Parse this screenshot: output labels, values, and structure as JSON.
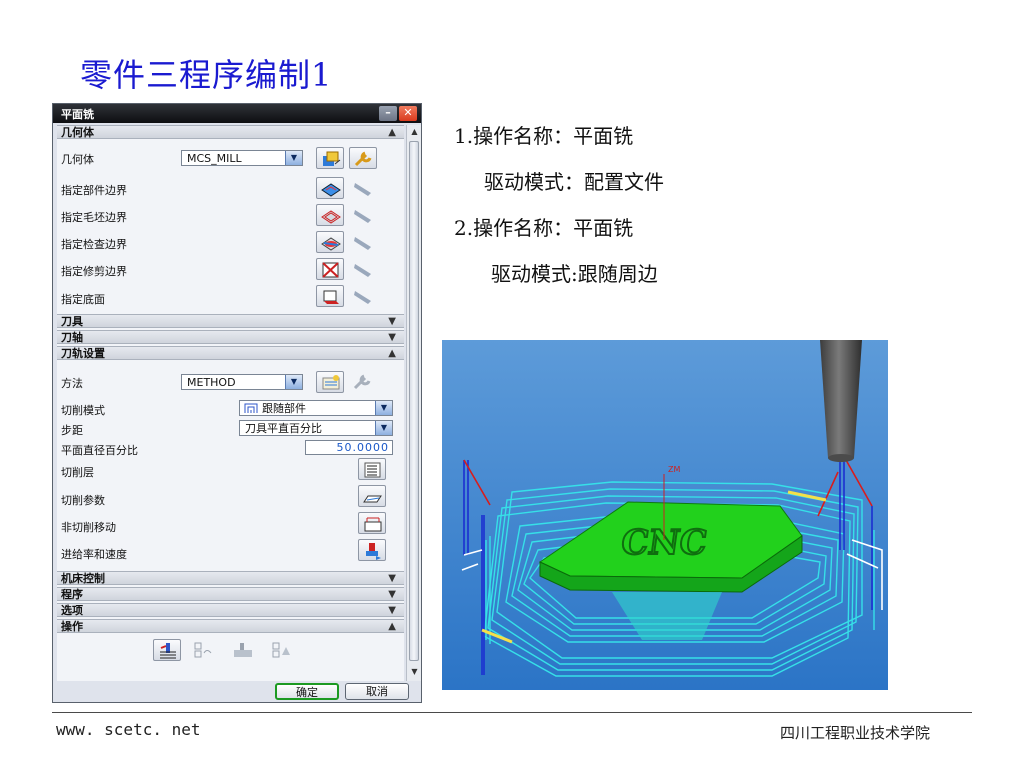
{
  "slide": {
    "title": "零件三程序编制1",
    "footer_url": "www. scetc. net",
    "footer_school": "四川工程职业技术学院"
  },
  "dialog": {
    "title": "平面铣",
    "sections": {
      "geometry": "几何体",
      "tool": "刀具",
      "tool_axis": "刀轴",
      "path_settings": "刀轨设置",
      "machine_control": "机床控制",
      "program": "程序",
      "options": "选项",
      "actions": "操作"
    },
    "geometry_rows": {
      "geometry_label": "几何体",
      "geometry_value": "MCS_MILL",
      "part_boundary": "指定部件边界",
      "blank_boundary": "指定毛坯边界",
      "check_boundary": "指定检查边界",
      "trim_boundary": "指定修剪边界",
      "floor": "指定底面"
    },
    "path_rows": {
      "method_label": "方法",
      "method_value": "METHOD",
      "cut_pattern_label": "切削模式",
      "cut_pattern_value": "跟随部件",
      "stepover_label": "步距",
      "stepover_value": "刀具平直百分比",
      "percent_label": "平面直径百分比",
      "percent_value": "50.0000",
      "cut_levels": "切削层",
      "cut_params": "切削参数",
      "non_cutting": "非切削移动",
      "feeds_speeds": "进给率和速度"
    },
    "buttons": {
      "ok": "确定",
      "cancel": "取消"
    },
    "colors": {
      "titlebar": "#1d1f24",
      "close": "#e0492b",
      "ok_border": "#1c9a22",
      "value_text": "#1a58c8"
    }
  },
  "info": {
    "line1": "1.操作名称：平面铣",
    "line2": "驱动模式：配置文件",
    "line3": "2.操作名称：平面铣",
    "line4": "驱动模式:跟随周边"
  },
  "render": {
    "axis_label": "ZM",
    "part_text": "CNC",
    "colors": {
      "background": "#3f86cf",
      "toolpath": "#36e0e8",
      "part": "#22d11c",
      "tool": "#6a6a6a"
    }
  }
}
